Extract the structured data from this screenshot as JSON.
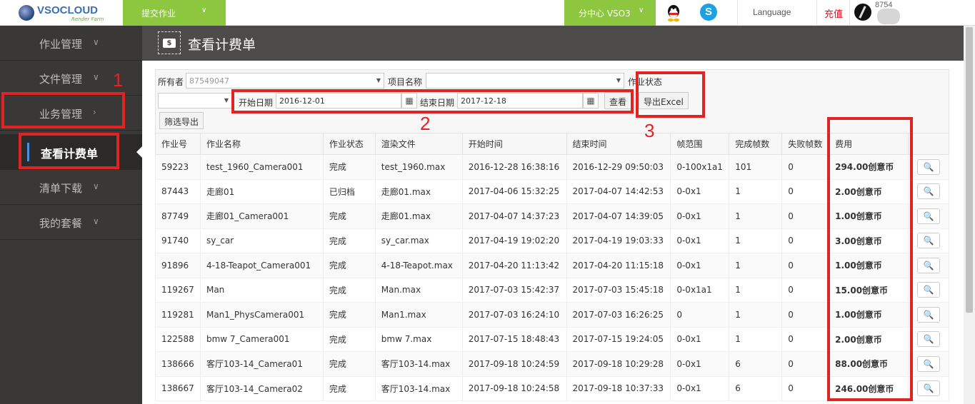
{
  "topbar": {
    "logo_text": "VSOCLOUD",
    "logo_sub": "Render Farm",
    "submit_job": "提交作业",
    "branch": "分中心 VSO3",
    "language": "Language",
    "recharge": "充值",
    "user_id": "8754"
  },
  "sidebar": {
    "items": [
      {
        "label": "作业管理"
      },
      {
        "label": "文件管理"
      },
      {
        "label": "业务管理"
      },
      {
        "label": "查看计费单"
      },
      {
        "label": "清单下载"
      },
      {
        "label": "我的套餐"
      }
    ]
  },
  "page": {
    "title": "查看计费单"
  },
  "filters": {
    "owner_label": "所有者",
    "owner_value": "87549047",
    "project_label": "项目名称",
    "project_value": "",
    "status_label": "作业状态",
    "start_label": "开始日期",
    "start_value": "2016-12-01",
    "end_label": "结束日期",
    "end_value": "2017-12-18",
    "view_btn": "查看",
    "export_btn": "导出Excel",
    "filter_export_btn": "筛选导出"
  },
  "table": {
    "headers": [
      "作业号",
      "作业名称",
      "作业状态",
      "渲染文件",
      "开始时间",
      "结束时间",
      "帧范围",
      "完成帧数",
      "失败帧数",
      "费用",
      ""
    ],
    "rows": [
      [
        "59223",
        "test_1960_Camera001",
        "完成",
        "test_1960.max",
        "2016-12-28 16:38:16",
        "2016-12-29 09:50:03",
        "0-100x1a1",
        "101",
        "0",
        "294.00创意币"
      ],
      [
        "87443",
        "走廊01",
        "已归档",
        "走廊01.max",
        "2017-04-06 15:32:25",
        "2017-04-07 14:42:53",
        "0-0x1",
        "1",
        "0",
        "2.00创意币"
      ],
      [
        "87749",
        "走廊01_Camera001",
        "完成",
        "走廊01.max",
        "2017-04-07 14:37:23",
        "2017-04-07 14:39:05",
        "0-0x1",
        "1",
        "0",
        "1.00创意币"
      ],
      [
        "91740",
        "sy_car",
        "完成",
        "sy_car.max",
        "2017-04-19 19:02:20",
        "2017-04-19 19:03:33",
        "0-0x1",
        "1",
        "0",
        "3.00创意币"
      ],
      [
        "91896",
        "4-18-Teapot_Camera001",
        "完成",
        "4-18-Teapot.max",
        "2017-04-20 11:13:42",
        "2017-04-20 11:15:18",
        "0-0x1",
        "1",
        "0",
        "1.00创意币"
      ],
      [
        "119267",
        "Man",
        "完成",
        "Man.max",
        "2017-07-03 15:42:37",
        "2017-07-03 15:45:18",
        "0-0x1a1",
        "1",
        "0",
        "15.00创意币"
      ],
      [
        "119281",
        "Man1_PhysCamera001",
        "完成",
        "Man1.max",
        "2017-07-03 16:24:10",
        "2017-07-03 16:26:25",
        "0",
        "1",
        "0",
        "1.00创意币"
      ],
      [
        "122588",
        "bmw 7_Camera001",
        "完成",
        "bmw 7.max",
        "2017-07-15 18:48:43",
        "2017-07-15 19:24:05",
        "0-0x1",
        "1",
        "0",
        "2.00创意币"
      ],
      [
        "138666",
        "客厅103-14_Camera01",
        "完成",
        "客厅103-14.max",
        "2017-09-18 10:24:59",
        "2017-09-18 10:29:28",
        "0-0x1",
        "6",
        "0",
        "88.00创意币"
      ],
      [
        "138667",
        "客厅103-14_Camera02",
        "完成",
        "客厅103-14.max",
        "2017-09-18 10:24:58",
        "2017-09-18 10:37:33",
        "0-0x1",
        "6",
        "0",
        "246.00创意币"
      ]
    ]
  },
  "annotations": [
    "1",
    "2",
    "3"
  ],
  "colors": {
    "accent_green": "#8dc63f",
    "sidebar": "#3a3836",
    "annotation_red": "#e02424"
  }
}
